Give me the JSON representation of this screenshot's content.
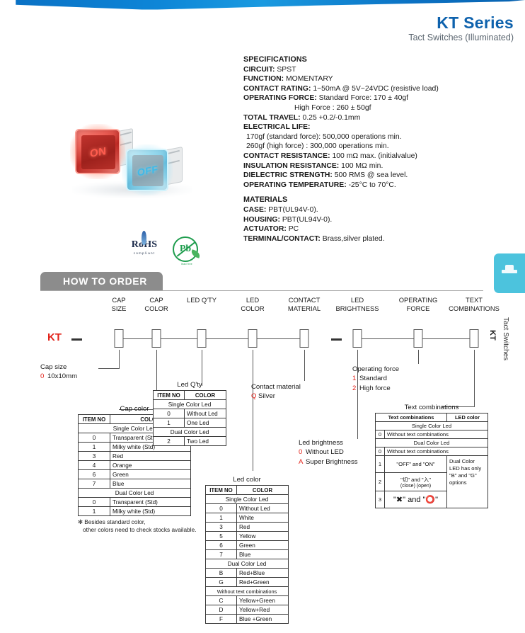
{
  "header": {
    "title": "KT Series",
    "subtitle": "Tact Switches (Illuminated)"
  },
  "product_photo": {
    "switch_red_legend": "ON",
    "switch_blue_legend": "OFF"
  },
  "certifications": {
    "rohs_word": "RoHS",
    "rohs_sub": "compliant",
    "pb_symbol": "Pb",
    "pb_caption": "lead free"
  },
  "specifications": {
    "heading": "SPECIFICATIONS",
    "items": [
      {
        "label": "CIRCUIT:",
        "value": "SPST"
      },
      {
        "label": "FUNCTION:",
        "value": "MOMENTARY"
      },
      {
        "label": "CONTACT RATING:",
        "value": "1~50mA @ 5V~24VDC (resistive load)"
      },
      {
        "label": "OPERATING  FORCE:",
        "value": "Standard Force: 170 ± 40gf"
      }
    ],
    "operating_force_second_line": "High Force       : 260 ± 50gf",
    "items2": [
      {
        "label": "TOTAL TRAVEL:",
        "value": "0.25 +0.2/-0.1mm"
      }
    ],
    "electrical_life_label": "ELECTRICAL LIFE:",
    "electrical_life_lines": [
      "170gf (standard force): 500,000 operations min.",
      "260gf (high force)      : 300,000 operations min."
    ],
    "items3": [
      {
        "label": "CONTACT RESISTANCE:",
        "value": "100 mΩ max. (initialvalue)"
      },
      {
        "label": "INSULATION RESISTANCE:",
        "value": "100 MΩ min."
      },
      {
        "label": "DIELECTRIC STRENGTH:",
        "value": "500 RMS @ sea level."
      },
      {
        "label": "OPERATING TEMPERATURE:",
        "value": "-25°C to 70°C."
      }
    ],
    "materials_heading": "MATERIALS",
    "materials": [
      {
        "label": "CASE:",
        "value": "PBT(UL94V-0)."
      },
      {
        "label": "HOUSING:",
        "value": "PBT(UL94V-0)."
      },
      {
        "label": "ACTUATOR:",
        "value": "PC"
      },
      {
        "label": "TERMINAL/CONTACT:",
        "value": "Brass,silver plated."
      }
    ]
  },
  "how_to_order": {
    "banner": "HOW TO ORDER",
    "prefix": "KT",
    "columns": [
      {
        "line1": "CAP",
        "line2": "SIZE"
      },
      {
        "line1": "CAP",
        "line2": "COLOR"
      },
      {
        "line1": "LED Q'TY",
        "line2": ""
      },
      {
        "line1": "LED",
        "line2": "COLOR"
      },
      {
        "line1": "CONTACT",
        "line2": "MATERIAL"
      },
      {
        "line1": "LED",
        "line2": "BRIGHTNESS"
      },
      {
        "line1": "OPERATING",
        "line2": "FORCE"
      },
      {
        "line1": "TEXT",
        "line2": "COMBINATIONS"
      }
    ]
  },
  "cap_size": {
    "title": "Cap size",
    "options": [
      {
        "code": "0",
        "text": "10x10mm"
      }
    ]
  },
  "cap_color": {
    "title": "Cap color",
    "header": [
      "ITEM NO",
      "COLOR"
    ],
    "groups": [
      {
        "name": "Single Color Led",
        "rows": [
          {
            "code": "0",
            "color": "Transparent (Std)"
          },
          {
            "code": "1",
            "color": "Milky white (Std)"
          },
          {
            "code": "3",
            "color": "Red"
          },
          {
            "code": "4",
            "color": "Orange"
          },
          {
            "code": "6",
            "color": "Green"
          },
          {
            "code": "7",
            "color": "Blue"
          }
        ]
      },
      {
        "name": "Dual Color Led",
        "rows": [
          {
            "code": "0",
            "color": "Transparent (Std)"
          },
          {
            "code": "1",
            "color": "Milky white (Std)"
          }
        ]
      }
    ],
    "note_line1": "✻ Besides standard color,",
    "note_line2": "other colors need to check stocks available."
  },
  "led_qty": {
    "title": "Led Q'ty",
    "header": [
      "ITEM NO",
      "COLOR"
    ],
    "groups": [
      {
        "name": "Single Color Led",
        "rows": [
          {
            "code": "0",
            "color": "Without Led"
          },
          {
            "code": "1",
            "color": "One Led"
          }
        ]
      },
      {
        "name": "Dual Color Led",
        "rows": [
          {
            "code": "2",
            "color": "Two Led"
          }
        ]
      }
    ]
  },
  "led_color": {
    "title": "Led color",
    "header": [
      "ITEM NO",
      "COLOR"
    ],
    "groups": [
      {
        "name": "Single Color Led",
        "rows": [
          {
            "code": "0",
            "color": "Without Led"
          },
          {
            "code": "1",
            "color": "White"
          },
          {
            "code": "3",
            "color": "Red"
          },
          {
            "code": "5",
            "color": "Yellow"
          },
          {
            "code": "6",
            "color": "Green"
          },
          {
            "code": "7",
            "color": "Blue"
          }
        ]
      },
      {
        "name": "Dual Color Led",
        "rows": [
          {
            "code": "B",
            "color": "Red+Blue"
          },
          {
            "code": "G",
            "color": "Red+Green"
          }
        ]
      },
      {
        "name": "Without text combinations",
        "rows": [
          {
            "code": "C",
            "color": "Yellow+Green"
          },
          {
            "code": "D",
            "color": "Yellow+Red"
          },
          {
            "code": "F",
            "color": "Blue +Green"
          }
        ]
      }
    ]
  },
  "contact_material": {
    "title": "Contact material",
    "options": [
      {
        "code": "Q",
        "text": "Silver"
      }
    ]
  },
  "led_brightness": {
    "title": "Led brightness",
    "options": [
      {
        "code": "0",
        "text": "Without LED"
      },
      {
        "code": "A",
        "text": "Super Brightness"
      }
    ]
  },
  "operating_force": {
    "title": "Operating force",
    "options": [
      {
        "code": "1",
        "text": "Standard"
      },
      {
        "code": "2",
        "text": "High force"
      }
    ]
  },
  "text_combinations": {
    "title": "Text combinations",
    "header": [
      "Text combinations",
      "LED color"
    ],
    "single_group": "Single Color Led",
    "single_rows": [
      {
        "code": "0",
        "text": "Without text combinations"
      }
    ],
    "dual_group": "Dual Color Led",
    "dual_rows": [
      {
        "code": "0",
        "text": "Without text combinations"
      }
    ],
    "combo_rows": [
      {
        "code": "1",
        "text": "\"OFF\"  and  \"ON\"",
        "sub": ""
      },
      {
        "code": "2",
        "text": "\"切\"  and  \"入\"",
        "sub": "(close)     (open)"
      },
      {
        "code": "3",
        "text": "\"✖\"  and  \"⭕\"",
        "sub": ""
      }
    ],
    "side_note": "Dual Color LED has only \"B\" and \"G\" options"
  },
  "side_tab": {
    "series": "KT",
    "category": "Tact Switches"
  },
  "colors": {
    "brand_blue": "#0e62ad",
    "accent_red": "#e2231a",
    "banner_gray": "#8c8c8c",
    "tab_cyan": "#4cc3dd"
  }
}
